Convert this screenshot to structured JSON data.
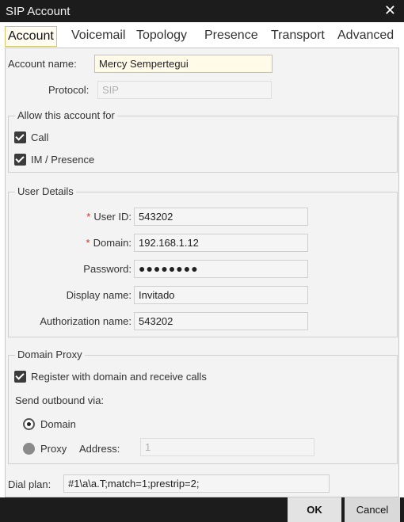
{
  "window": {
    "title": "SIP Account"
  },
  "tabs": [
    "Account",
    "Voicemail",
    "Topology",
    "Presence",
    "Transport",
    "Advanced"
  ],
  "account": {
    "name_label": "Account name:",
    "name_value": "Mercy Sempertegui",
    "protocol_label": "Protocol:",
    "protocol_value": "SIP"
  },
  "allow": {
    "title": "Allow this account for",
    "call_label": "Call",
    "call_checked": true,
    "im_label": "IM / Presence",
    "im_checked": true
  },
  "user_details": {
    "title": "User Details",
    "required_mark": "*",
    "user_id_label": "User ID:",
    "user_id_value": "543202",
    "domain_label": "Domain:",
    "domain_value": "192.168.1.12",
    "password_label": "Password:",
    "password_value": "●●●●●●●●",
    "display_name_label": "Display name:",
    "display_name_value": "Invitado",
    "auth_name_label": "Authorization name:",
    "auth_name_value": "543202"
  },
  "domain_proxy": {
    "title": "Domain Proxy",
    "register_label": "Register with domain and receive calls",
    "register_checked": true,
    "send_outbound_label": "Send outbound via:",
    "domain_option_label": "Domain",
    "proxy_option_label": "Proxy",
    "selected_option": "Domain",
    "address_label": "Address:",
    "address_value": "1"
  },
  "dial_plan": {
    "label": "Dial plan:",
    "value": "#1\\a\\a.T;match=1;prestrip=2;"
  },
  "footer": {
    "ok_label": "OK",
    "cancel_label": "Cancel"
  },
  "colors": {
    "titlebar": "#1c1c1c",
    "panel": "#f3f3f3",
    "highlight_border": "#e7c441",
    "required": "#d0322b"
  }
}
